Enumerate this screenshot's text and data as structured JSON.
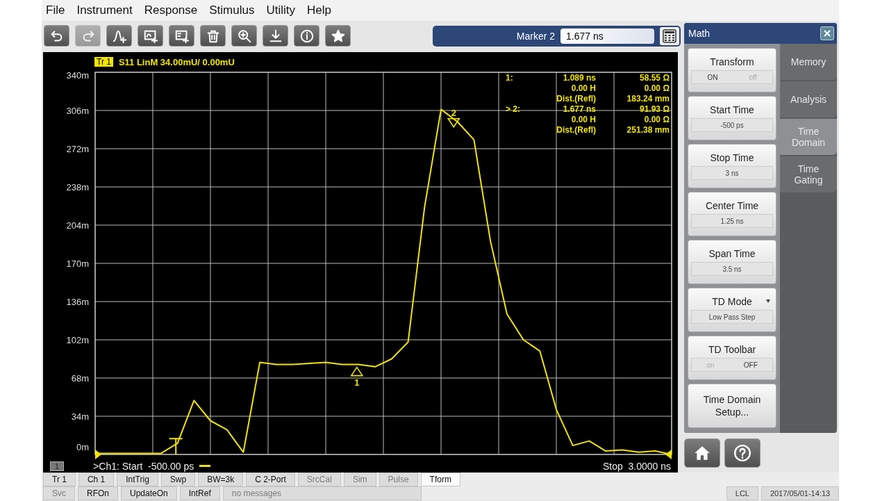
{
  "menu": [
    "File",
    "Instrument",
    "Response",
    "Stimulus",
    "Utility",
    "Help"
  ],
  "toolbar": [
    {
      "kind": "undo",
      "disabled": false
    },
    {
      "kind": "redo",
      "disabled": true
    },
    {
      "kind": "add-trace",
      "disabled": false
    },
    {
      "kind": "add-window",
      "disabled": false
    },
    {
      "kind": "add-channel",
      "disabled": false
    },
    {
      "kind": "trash",
      "disabled": false
    },
    {
      "kind": "zoom",
      "disabled": false
    },
    {
      "kind": "download",
      "disabled": false
    },
    {
      "kind": "info",
      "disabled": false
    },
    {
      "kind": "star",
      "disabled": false
    }
  ],
  "marker_entry": {
    "label": "Marker 2",
    "value": "1.677 ns"
  },
  "trace_header": {
    "badge": "Tr 1",
    "text": "S11 LinM 34.00mU/ 0.00mU"
  },
  "chart": {
    "chart_data": {
      "type": "line",
      "ylim": [
        0,
        340
      ],
      "grid": true,
      "yticks": [
        {
          "value": 0,
          "label": "0m"
        },
        {
          "value": 34,
          "label": "34m"
        },
        {
          "value": 68,
          "label": "68m"
        },
        {
          "value": 102,
          "label": "102m"
        },
        {
          "value": 136,
          "label": "136m"
        },
        {
          "value": 170,
          "label": "170m"
        },
        {
          "value": 204,
          "label": "204m"
        },
        {
          "value": 238,
          "label": "238m"
        },
        {
          "value": 272,
          "label": "272m"
        },
        {
          "value": 306,
          "label": "306m"
        },
        {
          "value": 340,
          "label": "340m"
        }
      ],
      "categories": [
        null,
        null,
        null,
        null,
        null,
        null,
        null,
        null,
        null,
        null,
        null,
        null,
        null,
        null,
        null,
        null,
        null,
        null,
        null,
        null,
        null,
        null,
        null,
        null,
        null,
        null,
        null,
        null,
        null,
        null,
        null,
        null,
        null,
        null,
        null,
        null
      ],
      "series": [
        {
          "color": "#f2e600",
          "values": [
            1,
            1,
            1,
            1,
            1,
            10,
            48,
            30,
            22,
            2,
            82,
            80,
            80,
            81,
            82,
            80,
            80,
            78,
            85,
            100,
            220,
            307,
            296,
            280,
            190,
            125,
            102,
            92,
            40,
            8,
            12,
            3,
            4,
            2,
            3,
            0
          ]
        }
      ]
    }
  },
  "plot_markers": [
    {
      "label": "1",
      "kind": "up"
    },
    {
      "label": "2",
      "kind": "down"
    }
  ],
  "marker_readout": [
    {
      "label": "1:",
      "rows": [
        [
          "1.089 ns",
          "58.55 Ω"
        ],
        [
          "0.00 H",
          "0.00 Ω"
        ],
        [
          "Dist.(Refl)",
          "183.24 mm"
        ]
      ]
    },
    {
      "label": "> 2:",
      "rows": [
        [
          "1.677 ns",
          "91.93 Ω"
        ],
        [
          "0.00 H",
          "0.00 Ω"
        ],
        [
          "Dist.(Refl)",
          "251.38 mm"
        ]
      ]
    }
  ],
  "chart_footer": {
    "channel_badge": "1",
    "start": ">Ch1: Start  -500.00 ps",
    "stop": "Stop  3.0000 ns"
  },
  "math_panel": {
    "title": "Math",
    "softkeys": [
      {
        "kind": "toggle",
        "title": "Transform",
        "options": [
          {
            "label": "ON",
            "selected": true
          },
          {
            "label": "off",
            "selected": false
          }
        ]
      },
      {
        "kind": "value",
        "title": "Start Time",
        "value": "-500 ps"
      },
      {
        "kind": "value",
        "title": "Stop Time",
        "value": "3 ns"
      },
      {
        "kind": "value",
        "title": "Center Time",
        "value": "1.25 ns"
      },
      {
        "kind": "value",
        "title": "Span Time",
        "value": "3.5 ns"
      },
      {
        "kind": "dropdown",
        "title": "TD Mode",
        "value": "Low Pass Step"
      },
      {
        "kind": "toggle",
        "title": "TD Toolbar",
        "options": [
          {
            "label": "on",
            "selected": false
          },
          {
            "label": "OFF",
            "selected": true
          }
        ]
      },
      {
        "kind": "action",
        "title": "Time Domain Setup..."
      }
    ],
    "tabs": [
      {
        "label": "Memory",
        "selected": false
      },
      {
        "label": "Analysis",
        "selected": false
      },
      {
        "label": "Time Domain",
        "selected": true
      },
      {
        "label": "Time Gating",
        "selected": false
      }
    ]
  },
  "status_bar_1": [
    {
      "label": "Tr 1",
      "disabled": false
    },
    {
      "label": "Ch 1",
      "disabled": false
    },
    {
      "label": "IntTrig",
      "disabled": false
    },
    {
      "label": "Swp",
      "disabled": false
    },
    {
      "label": "BW=3k",
      "disabled": false
    },
    {
      "label": "C  2-Port",
      "disabled": false
    },
    {
      "label": "SrcCal",
      "disabled": true
    },
    {
      "label": "Sim",
      "disabled": true
    },
    {
      "label": "Pulse",
      "disabled": true
    },
    {
      "label": "Tform",
      "disabled": false
    }
  ],
  "status_bar_2": [
    {
      "label": "Svc",
      "disabled": true
    },
    {
      "label": "RFOn",
      "disabled": false
    },
    {
      "label": "UpdateOn",
      "disabled": false
    },
    {
      "label": "IntRef",
      "disabled": false
    },
    {
      "label": "no messages",
      "disabled": true
    }
  ],
  "status_right": [
    "LCL",
    "2017/05/01-14:13"
  ]
}
